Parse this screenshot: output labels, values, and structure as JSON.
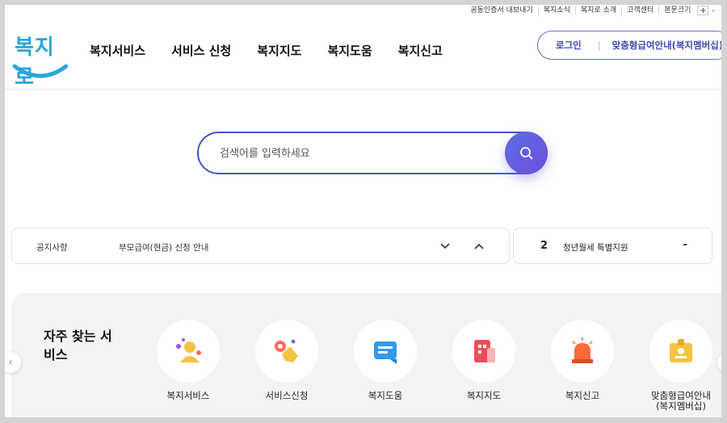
{
  "utility": {
    "items": [
      "공동인증서 내보내기",
      "복지소식",
      "복지로 소개",
      "고객센터",
      "본문크기"
    ],
    "plus": "+",
    "minus": "-"
  },
  "logo": {
    "text": "복지로"
  },
  "gnb": [
    "복지서비스",
    "서비스 신청",
    "복지지도",
    "복지도움",
    "복지신고"
  ],
  "account": {
    "login": "로그인",
    "custom": "맞춤형급여안내(복지멤버십)"
  },
  "search": {
    "placeholder": "검색어를 입력하세요"
  },
  "notice": {
    "label": "공지사항",
    "text": "부모급여(현금) 신청 안내"
  },
  "ranking": {
    "number": "2",
    "title": "청년월세 특별지원",
    "change": "-"
  },
  "frequent": {
    "title": "자주 찾는 서비스",
    "items": [
      {
        "label": "복지서비스",
        "icon": "welfare-service-icon"
      },
      {
        "label": "서비스신청",
        "icon": "service-apply-icon"
      },
      {
        "label": "복지도움",
        "icon": "welfare-help-icon"
      },
      {
        "label": "복지지도",
        "icon": "welfare-map-icon"
      },
      {
        "label": "복지신고",
        "icon": "welfare-report-icon"
      },
      {
        "label": "맞춤형급여안내\n(복지멤버십)",
        "icon": "custom-benefit-icon"
      }
    ]
  },
  "colors": {
    "accent": "#4356c8",
    "logo": "#2aa6db",
    "panel": "#f3f3f3"
  }
}
